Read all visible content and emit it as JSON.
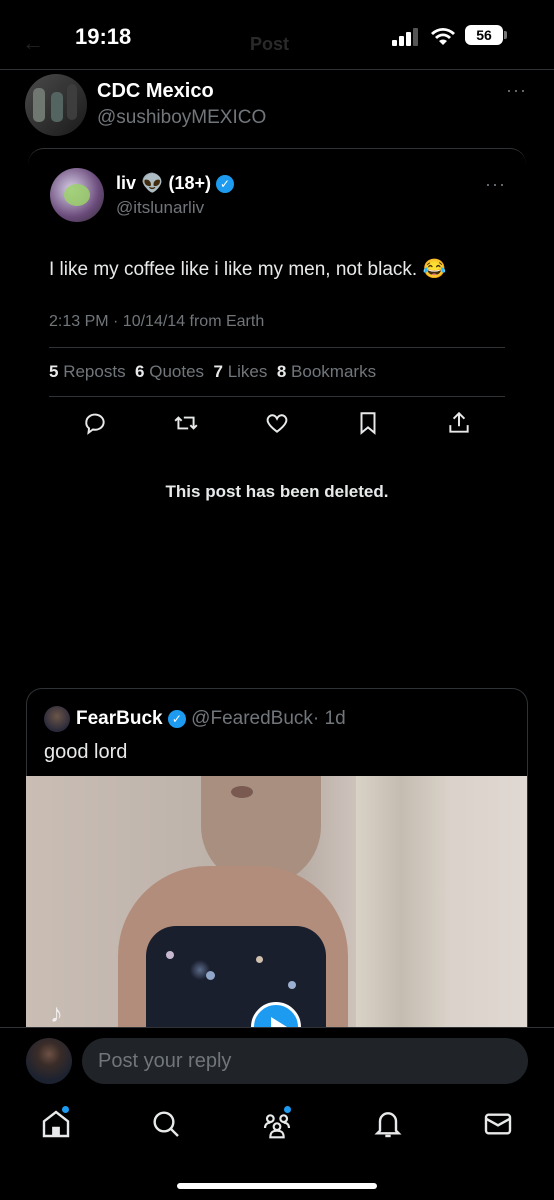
{
  "status_bar": {
    "time": "19:18",
    "battery": "56",
    "ghost_title": "Post"
  },
  "main_post": {
    "author_name": "CDC Mexico",
    "author_handle": "@sushiboyMEXICO",
    "more": "···"
  },
  "quoted_post": {
    "author_name": "liv",
    "emoji": "👽",
    "tag": "(18+)",
    "author_handle": "@itslunarliv",
    "more": "···",
    "text": "I like my coffee like i like my men, not black.",
    "text_emoji": "😂",
    "meta": "2:13 PM · 10/14/14 from Earth",
    "stats": {
      "reposts_count": "5",
      "reposts_label": "Reposts",
      "quotes_count": "6",
      "quotes_label": "Quotes",
      "likes_count": "7",
      "likes_label": "Likes",
      "bookmarks_count": "8",
      "bookmarks_label": "Bookmarks"
    }
  },
  "deleted_notice": "This post has been deleted.",
  "nested_quote": {
    "author_name": "FearBuck",
    "author_handle": "@FearedBuck",
    "time": "· 1d",
    "text": "good lord",
    "watermark": "♪"
  },
  "reply_bar": {
    "placeholder": "Post your reply"
  },
  "tab_bar": {
    "home": "home-icon",
    "search": "search-icon",
    "communities": "communities-icon",
    "notifications": "bell-icon",
    "messages": "mail-icon"
  },
  "colors": {
    "accent": "#1d9bf0",
    "background": "#000000",
    "muted": "#71767b"
  }
}
